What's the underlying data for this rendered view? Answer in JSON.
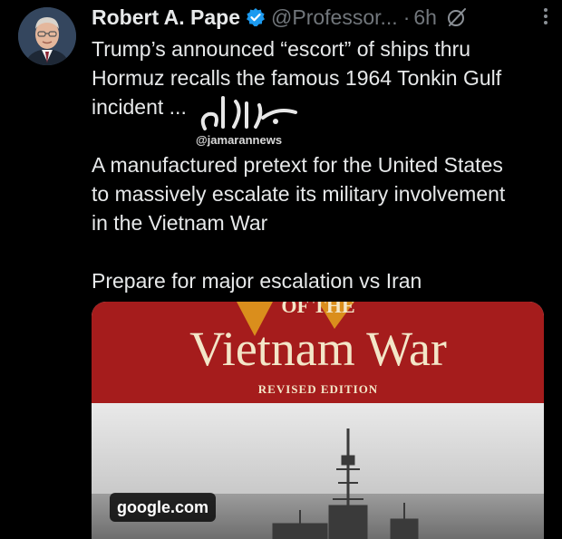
{
  "author": {
    "name": "Robert A. Pape",
    "handle": "@Professor...",
    "separator": "·",
    "time": "6h"
  },
  "tweet": {
    "lines": [
      "Trump’s announced “escort” of ships thru",
      "Hormuz recalls the famous 1964 Tonkin Gulf",
      "incident ...",
      "A manufactured pretext for the United States",
      "to massively escalate its military involvement",
      "in the Vietnam War",
      "Prepare for major escalation vs Iran"
    ]
  },
  "watermark": {
    "handle": "@jamarannews"
  },
  "media": {
    "top_fragment": "OF THE",
    "title": "Vietnam War",
    "subtitle": "REVISED EDITION",
    "source_chip": "google.com"
  },
  "colors": {
    "background": "#000000",
    "text": "#e7e9ea",
    "muted": "#71767b",
    "verified": "#1d9bf0",
    "book_red": "#a51c1c",
    "book_cream": "#f3e6c8"
  },
  "icons": {
    "verified": "verified-badge-icon",
    "grok": "grok-icon",
    "more": "more-options-icon"
  }
}
